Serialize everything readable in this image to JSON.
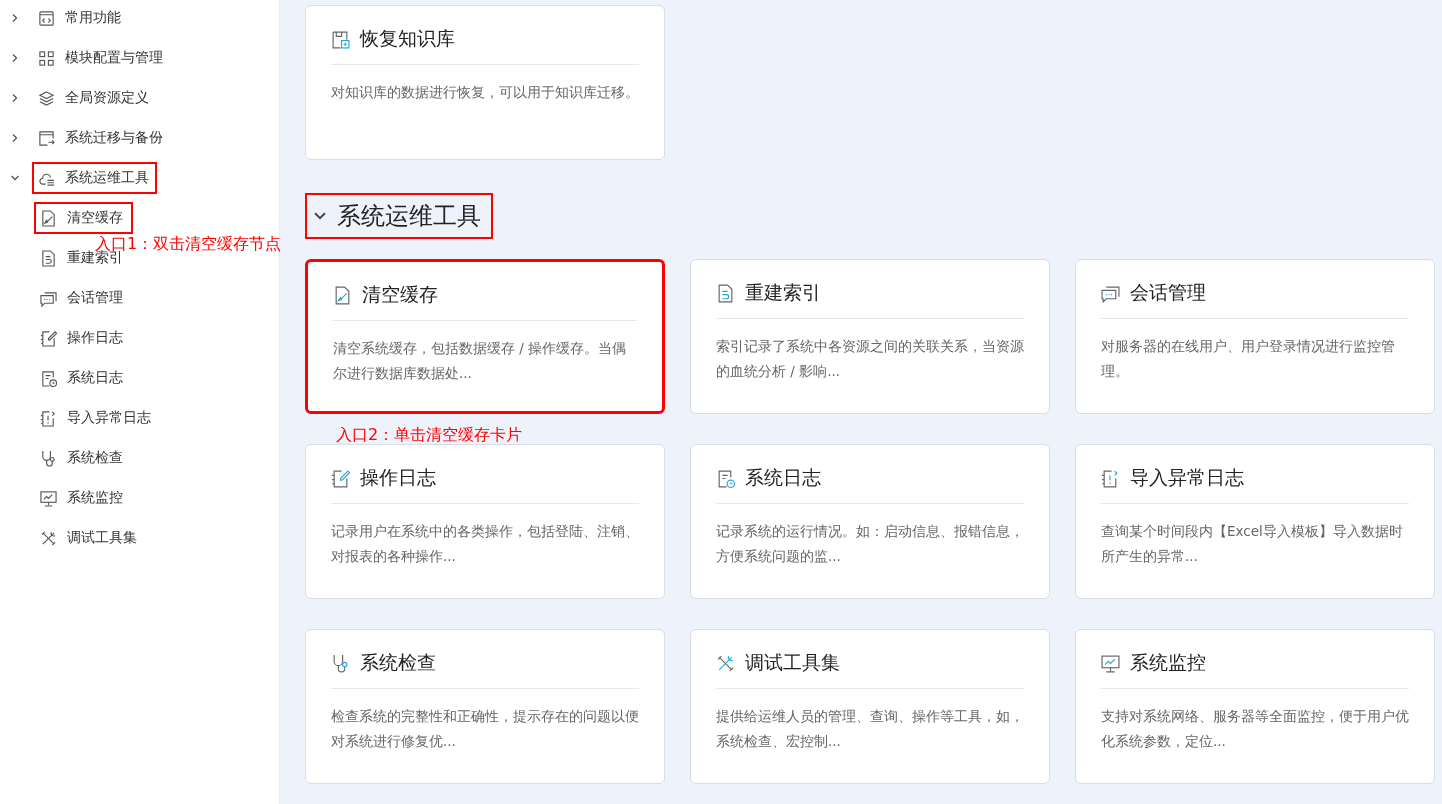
{
  "sidebar": {
    "items": [
      {
        "label": "常用功能",
        "kind": "code",
        "expanded": false,
        "highlighted": false
      },
      {
        "label": "模块配置与管理",
        "kind": "grid",
        "expanded": false,
        "highlighted": false
      },
      {
        "label": "全局资源定义",
        "kind": "layers",
        "expanded": false,
        "highlighted": false
      },
      {
        "label": "系统迁移与备份",
        "kind": "export",
        "expanded": false,
        "highlighted": false
      },
      {
        "label": "系统运维工具",
        "kind": "cloud",
        "expanded": true,
        "highlighted": true,
        "children": [
          {
            "label": "清空缓存",
            "kind": "broom",
            "highlighted": true,
            "note": "入口1：双击清空缓存节点"
          },
          {
            "label": "重建索引",
            "kind": "index",
            "highlighted": false
          },
          {
            "label": "会话管理",
            "kind": "chat",
            "highlighted": false
          },
          {
            "label": "操作日志",
            "kind": "edit",
            "highlighted": false
          },
          {
            "label": "系统日志",
            "kind": "clock",
            "highlighted": false
          },
          {
            "label": "导入异常日志",
            "kind": "alert",
            "highlighted": false
          },
          {
            "label": "系统检查",
            "kind": "stetho",
            "highlighted": false
          },
          {
            "label": "系统监控",
            "kind": "monitor",
            "highlighted": false
          },
          {
            "label": "调试工具集",
            "kind": "tools",
            "highlighted": false
          }
        ]
      }
    ]
  },
  "main": {
    "top_cards": [
      {
        "title": "恢复知识库",
        "kind": "restore",
        "description": "对知识库的数据进行恢复，可以用于知识库迁移。",
        "highlighted": false
      }
    ],
    "sections": [
      {
        "title": "系统运维工具",
        "expanded": true,
        "highlighted": true,
        "cards": [
          {
            "title": "清空缓存",
            "kind": "broom",
            "description": "清空系统缓存，包括数据缓存 / 操作缓存。当偶尔进行数据库数据处...",
            "highlighted": true,
            "note": "入口2：单击清空缓存卡片"
          },
          {
            "title": "重建索引",
            "kind": "index",
            "description": "索引记录了系统中各资源之间的关联关系，当资源的血统分析 / 影响...",
            "highlighted": false
          },
          {
            "title": "会话管理",
            "kind": "chat",
            "description": "对服务器的在线用户、用户登录情况进行监控管理。",
            "highlighted": false
          },
          {
            "title": "操作日志",
            "kind": "edit",
            "description": "记录用户在系统中的各类操作，包括登陆、注销、对报表的各种操作...",
            "highlighted": false
          },
          {
            "title": "系统日志",
            "kind": "clock",
            "description": "记录系统的运行情况。如：启动信息、报错信息，方便系统问题的监...",
            "highlighted": false
          },
          {
            "title": "导入异常日志",
            "kind": "alert",
            "description": "查询某个时间段内【Excel导入模板】导入数据时所产生的异常...",
            "highlighted": false
          },
          {
            "title": "系统检查",
            "kind": "stetho",
            "description": "检查系统的完整性和正确性，提示存在的问题以便对系统进行修复优...",
            "highlighted": false
          },
          {
            "title": "调试工具集",
            "kind": "tools",
            "description": "提供给运维人员的管理、查询、操作等工具，如，系统检查、宏控制...",
            "highlighted": false
          },
          {
            "title": "系统监控",
            "kind": "monitor",
            "description": "支持对系统网络、服务器等全面监控，便于用户优化系统参数，定位...",
            "highlighted": false
          }
        ]
      }
    ]
  }
}
